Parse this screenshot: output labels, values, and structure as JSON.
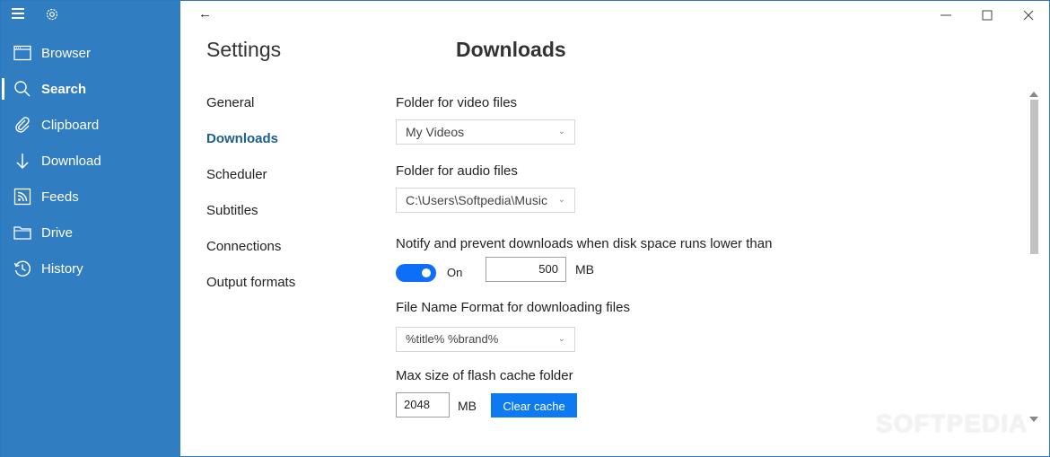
{
  "sidebar": {
    "menu_icon": "hamburger-icon",
    "settings_icon": "gear-icon",
    "items": [
      {
        "label": "Browser",
        "icon": "browser-window-icon",
        "active": false
      },
      {
        "label": "Search",
        "icon": "search-icon",
        "active": true
      },
      {
        "label": "Clipboard",
        "icon": "paperclip-icon",
        "active": false
      },
      {
        "label": "Download",
        "icon": "arrow-down-icon",
        "active": false
      },
      {
        "label": "Feeds",
        "icon": "rss-feed-icon",
        "active": false
      },
      {
        "label": "Drive",
        "icon": "folder-icon",
        "active": false
      },
      {
        "label": "History",
        "icon": "history-clock-icon",
        "active": false
      }
    ]
  },
  "window": {
    "back_glyph": "←",
    "minimize_glyph": "—",
    "maximize_glyph": "☐",
    "close_glyph": "✕"
  },
  "settings": {
    "title": "Settings",
    "section_title": "Downloads",
    "subnav": [
      {
        "label": "General",
        "active": false
      },
      {
        "label": "Downloads",
        "active": true
      },
      {
        "label": "Scheduler",
        "active": false
      },
      {
        "label": "Subtitles",
        "active": false
      },
      {
        "label": "Connections",
        "active": false
      },
      {
        "label": "Output formats",
        "active": false
      }
    ]
  },
  "downloads": {
    "video_folder": {
      "label": "Folder for video files",
      "value": "My Videos"
    },
    "audio_folder": {
      "label": "Folder for audio files",
      "value": "C:\\Users\\Softpedia\\Music"
    },
    "disk_space": {
      "label": "Notify and prevent downloads when disk space runs lower than",
      "toggle_on": true,
      "toggle_label": "On",
      "value": "500",
      "unit": "MB"
    },
    "file_name_format": {
      "label": "File Name Format for downloading files",
      "value": "%title% %brand%"
    },
    "flash_cache": {
      "label": "Max size of flash cache folder",
      "value": "2048",
      "unit": "MB",
      "clear_button": "Clear cache"
    },
    "chevron_glyph": "⌄"
  },
  "colors": {
    "sidebar_bg": "#317dc1",
    "accent": "#0d7af2",
    "active_subnav": "#1b5f8f"
  },
  "watermark": "SOFTPEDIA"
}
